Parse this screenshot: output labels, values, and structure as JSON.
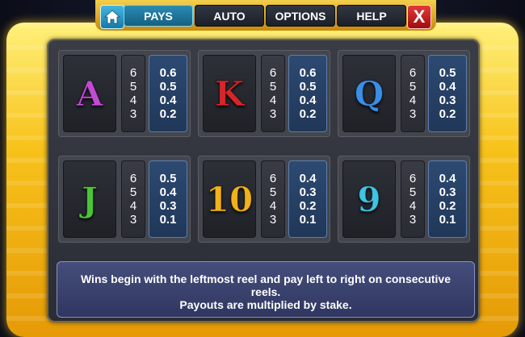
{
  "menu": {
    "tabs": [
      {
        "label": "PAYS",
        "active": true
      },
      {
        "label": "AUTO",
        "active": false
      },
      {
        "label": "OPTIONS",
        "active": false
      },
      {
        "label": "HELP",
        "active": false
      }
    ],
    "home_icon": "home-icon",
    "close_label": "X"
  },
  "paytable": [
    {
      "symbol": "A",
      "color": "#c24bd4",
      "counts": [
        "6",
        "5",
        "4",
        "3"
      ],
      "payouts": [
        "0.6",
        "0.5",
        "0.4",
        "0.2"
      ]
    },
    {
      "symbol": "K",
      "color": "#d7262a",
      "counts": [
        "6",
        "5",
        "4",
        "3"
      ],
      "payouts": [
        "0.6",
        "0.5",
        "0.4",
        "0.2"
      ]
    },
    {
      "symbol": "Q",
      "color": "#3a8ee6",
      "counts": [
        "6",
        "5",
        "4",
        "3"
      ],
      "payouts": [
        "0.5",
        "0.4",
        "0.3",
        "0.2"
      ]
    },
    {
      "symbol": "J",
      "color": "#4cc43a",
      "counts": [
        "6",
        "5",
        "4",
        "3"
      ],
      "payouts": [
        "0.5",
        "0.4",
        "0.3",
        "0.1"
      ]
    },
    {
      "symbol": "10",
      "color": "#f2b21c",
      "counts": [
        "6",
        "5",
        "4",
        "3"
      ],
      "payouts": [
        "0.4",
        "0.3",
        "0.2",
        "0.1"
      ]
    },
    {
      "symbol": "9",
      "color": "#3fc4e3",
      "counts": [
        "6",
        "5",
        "4",
        "3"
      ],
      "payouts": [
        "0.4",
        "0.3",
        "0.2",
        "0.1"
      ]
    }
  ],
  "info": {
    "line1": "Wins begin with the leftmost reel and pay left to right on consecutive reels.",
    "line2": "Payouts are multiplied by stake."
  }
}
